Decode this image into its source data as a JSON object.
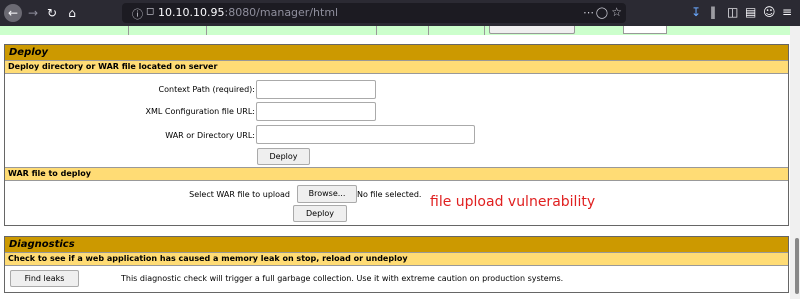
{
  "browser": {
    "url_host": "10.10.10.95",
    "url_rest": ":8080/manager/html"
  },
  "deploy": {
    "title": "Deploy",
    "server_subtitle": "Deploy directory or WAR file located on server",
    "context_path_label": "Context Path (required):",
    "xml_config_label": "XML Configuration file URL:",
    "war_dir_label": "WAR or Directory URL:",
    "deploy_button": "Deploy",
    "war_subtitle": "WAR file to deploy",
    "select_war_label": "Select WAR file to upload",
    "browse_button": "Browse...",
    "no_file_text": "No file selected.",
    "war_deploy_button": "Deploy"
  },
  "annotation": "file upload vulnerability",
  "diagnostics": {
    "title": "Diagnostics",
    "subtitle": "Check to see if a web application has caused a memory leak on stop, reload or undeploy",
    "find_leaks_button": "Find leaks",
    "description": "This diagnostic check will trigger a full garbage collection. Use it with extreme caution on production systems."
  }
}
